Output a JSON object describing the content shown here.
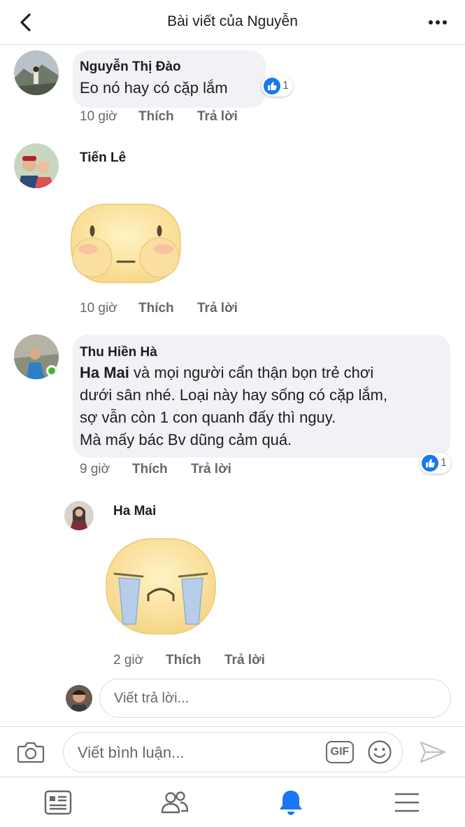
{
  "header": {
    "title": "Bài viết của Nguyễn"
  },
  "comments": [
    {
      "author": "Nguyễn Thị Đào",
      "text": "Eo nó hay có cặp lắm",
      "time": "10 giờ",
      "like": "Thích",
      "reply": "Trả lời",
      "reactions": "1"
    },
    {
      "author": "Tiến Lê",
      "sticker": "blushing-face-sticker",
      "time": "10 giờ",
      "like": "Thích",
      "reply": "Trả lời"
    },
    {
      "author": "Thu Hiền Hà",
      "mention": "Ha Mai",
      "lines": [
        " và mọi người cẩn thận bọn trẻ chơi",
        "dưới sân nhé. Loại này hay sống có cặp lắm,",
        "sợ vẫn còn 1 con quanh đấy thì nguy.",
        "Mà mấy bác Bv dũng cảm quá."
      ],
      "time": "9 giờ",
      "like": "Thích",
      "reply": "Trả lời",
      "reactions": "1"
    },
    {
      "author": "Ha Mai",
      "sticker": "crying-face-sticker",
      "time": "2 giờ",
      "like": "Thích",
      "reply": "Trả lời"
    }
  ],
  "reply_box": {
    "placeholder": "Viết trả lời..."
  },
  "composer": {
    "placeholder": "Viết bình luận...",
    "gif_label": "GIF"
  },
  "tabs": [
    "news-feed",
    "friends",
    "notifications",
    "menu"
  ],
  "colors": {
    "accent": "#1877f2",
    "bubble": "#f0f2f5",
    "secondary_text": "#65676b",
    "online": "#42b72a"
  }
}
